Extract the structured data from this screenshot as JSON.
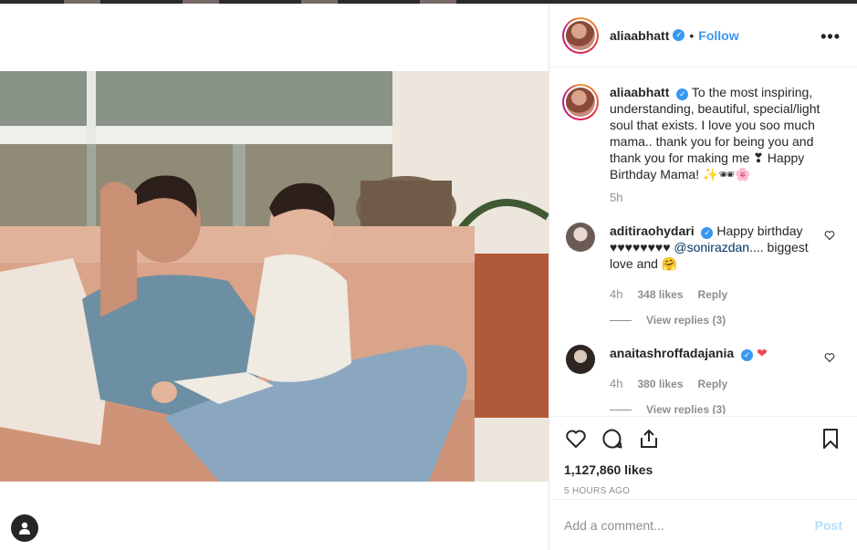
{
  "post": {
    "author": "aliaabhatt",
    "follow_label": "Follow",
    "separator": "•",
    "more_label": "•••",
    "caption_text": "To the most inspiring, understanding, beautiful, special/light soul that exists. I love you soo much mama.. thank you for being you and thank you for making me ❣ Happy Birthday Mama! ✨🕶🌸",
    "caption_age": "5h",
    "likes": "1,127,860 likes",
    "posted": "5 HOURS AGO"
  },
  "comments": [
    {
      "user": "aditiraohydari",
      "text_before": "Happy birthday ♥♥♥♥♥♥♥♥ ",
      "mention": "@sonirazdan",
      "text_after": ".... biggest love and 🤗",
      "time": "4h",
      "likes": "348 likes",
      "reply": "Reply",
      "view_replies": "View replies (3)"
    },
    {
      "user": "anaitashroffadajania",
      "text_before": "❤",
      "mention": "",
      "text_after": "",
      "time": "4h",
      "likes": "380 likes",
      "reply": "Reply",
      "view_replies": "View replies (3)"
    }
  ],
  "composer": {
    "placeholder": "Add a comment...",
    "post_label": "Post"
  },
  "icons": {
    "like": "heart-icon",
    "comment": "comment-bubble-icon",
    "share": "share-icon",
    "save": "bookmark-icon",
    "profile": "profile-icon",
    "verified": "verified-badge-icon"
  },
  "colors": {
    "accent": "#3897f0",
    "muted": "#8e8e8e",
    "text": "#262626",
    "post_disabled": "#b2dffc"
  }
}
